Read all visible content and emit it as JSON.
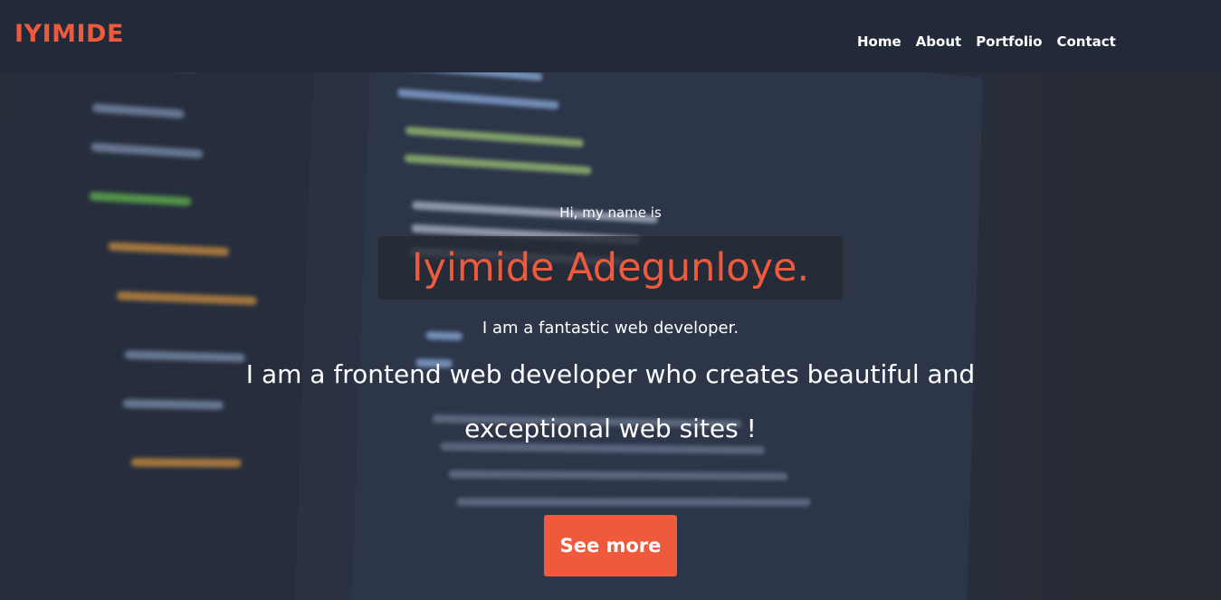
{
  "header": {
    "logo": "IYIMIDE",
    "nav": {
      "home": "Home",
      "about": "About",
      "portfolio": "Portfolio",
      "contact": "Contact"
    }
  },
  "hero": {
    "intro": "Hi, my name is",
    "name": "Iyimide Adegunloye.",
    "tagline": "I am a fantastic web developer.",
    "description": "I am a frontend web developer who creates beautiful and exceptional web sites !",
    "cta": "See more"
  },
  "colors": {
    "accent": "#ef5a3c",
    "navbar": "#222a39",
    "text": "#ffffff"
  }
}
